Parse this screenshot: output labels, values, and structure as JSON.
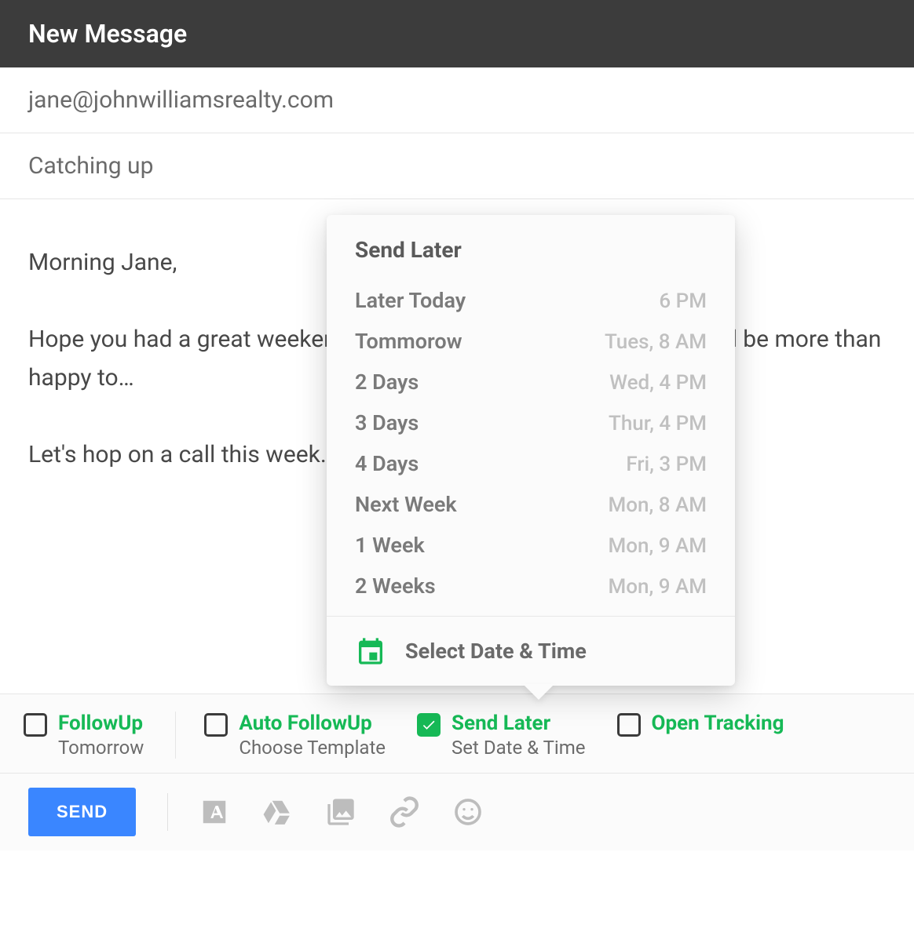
{
  "header": {
    "title": "New Message"
  },
  "to": "jane@johnwilliamsrealty.com",
  "subject": "Catching up",
  "body": {
    "greeting": "Morning Jane,",
    "p1": "Hope you had a great weekend. Per our conversation Thursday, we'd be more than happy to…",
    "p2": "Let's hop on a call this week."
  },
  "popover": {
    "title": "Send Later",
    "rows": [
      {
        "label": "Later Today",
        "time": "6 PM"
      },
      {
        "label": "Tommorow",
        "time": "Tues,  8 AM"
      },
      {
        "label": "2 Days",
        "time": "Wed, 4 PM"
      },
      {
        "label": "3 Days",
        "time": "Thur, 4 PM"
      },
      {
        "label": "4 Days",
        "time": "Fri, 3 PM"
      },
      {
        "label": "Next Week",
        "time": "Mon, 8 AM"
      },
      {
        "label": "1 Week",
        "time": "Mon, 9 AM"
      },
      {
        "label": "2 Weeks",
        "time": "Mon, 9 AM"
      }
    ],
    "footer": "Select Date & Time"
  },
  "options": {
    "followup": {
      "title": "FollowUp",
      "sub": "Tomorrow",
      "checked": false
    },
    "auto_followup": {
      "title": "Auto FollowUp",
      "sub": "Choose Template",
      "checked": false
    },
    "send_later": {
      "title": "Send Later",
      "sub": "Set Date & Time",
      "checked": true
    },
    "open_tracking": {
      "title": "Open Tracking",
      "sub": "",
      "checked": false
    }
  },
  "toolbar": {
    "send": "SEND"
  }
}
